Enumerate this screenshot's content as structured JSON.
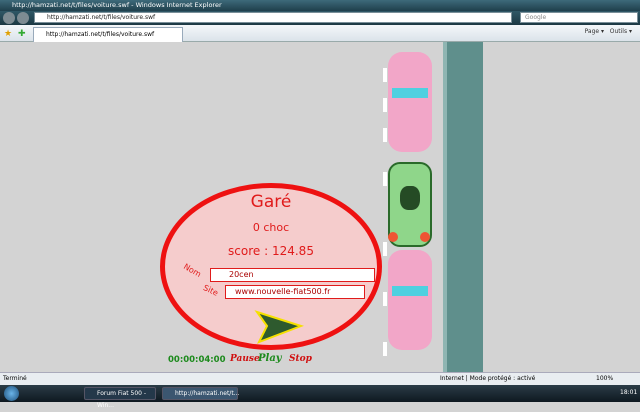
{
  "window": {
    "title": "http://hamzati.net/t/files/voiture.swf - Windows Internet Explorer",
    "address": "http://hamzati.net/t/files/voiture.swf",
    "search_placeholder": "Google",
    "tab": "http://hamzati.net/t/files/voiture.swf",
    "commands": [
      "Page",
      "Outils"
    ]
  },
  "game": {
    "status": "Garé",
    "crashes": "0 choc",
    "score": "score : 124.85",
    "name_label": "Nom",
    "name_value": "20cen",
    "site_label": "Site",
    "site_value": "www.nouvelle-fiat500.fr",
    "timer": "00:00:04:00",
    "pause": "Pause",
    "play": "Play",
    "stop": "Stop"
  },
  "statusbar": {
    "text": "Terminé",
    "zone": "Internet | Mode protégé : activé",
    "zoom": "100%"
  },
  "taskbar": {
    "items": [
      "Forum Fiat 500 - Win...",
      "http://hamzati.net/t..."
    ],
    "clock": "18:01"
  }
}
